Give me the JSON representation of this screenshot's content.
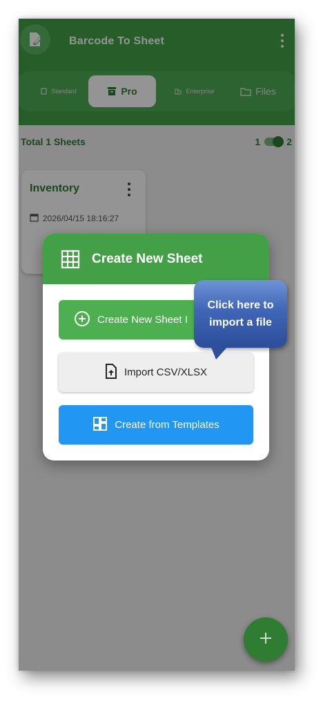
{
  "app": {
    "title": "Barcode To Sheet"
  },
  "tabs": [
    {
      "label": "Standard",
      "icon": "document-icon"
    },
    {
      "label": "Pro",
      "icon": "archive-icon"
    },
    {
      "label": "Enterprise",
      "icon": "building-icon"
    },
    {
      "label": "Files",
      "icon": "folder-icon"
    }
  ],
  "sheets": {
    "total_label": "Total 1 Sheets",
    "toggle_left": "1",
    "toggle_right": "2",
    "items": [
      {
        "name": "Inventory",
        "date": "2026/04/15 18:16:27"
      }
    ]
  },
  "dialog": {
    "title": "Create New Sheet",
    "create_button": "Create New Sheet I",
    "import_button": "Import CSV/XLSX",
    "template_button": "Create from Templates"
  },
  "callout": {
    "line1": "Click here to",
    "line2": "import a file"
  },
  "colors": {
    "primary": "#43a047",
    "dark_green": "#2e7d32",
    "blue": "#2196f3",
    "callout": "#3f66b7"
  }
}
